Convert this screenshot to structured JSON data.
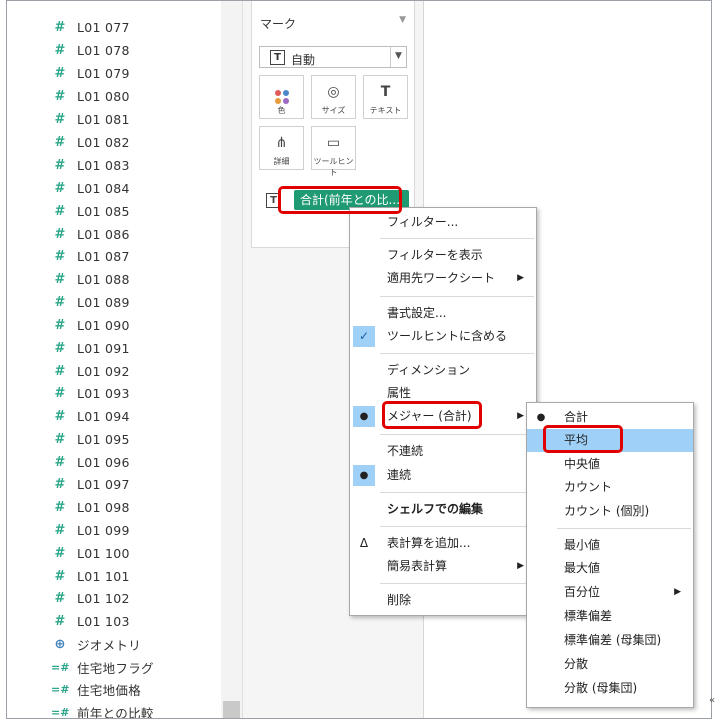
{
  "fields": [
    {
      "label": "L01 077",
      "icon": "hash-icon",
      "glyph": "#"
    },
    {
      "label": "L01 078",
      "icon": "hash-icon",
      "glyph": "#"
    },
    {
      "label": "L01 079",
      "icon": "hash-icon",
      "glyph": "#"
    },
    {
      "label": "L01 080",
      "icon": "hash-icon",
      "glyph": "#"
    },
    {
      "label": "L01 081",
      "icon": "hash-icon",
      "glyph": "#"
    },
    {
      "label": "L01 082",
      "icon": "hash-icon",
      "glyph": "#"
    },
    {
      "label": "L01 083",
      "icon": "hash-icon",
      "glyph": "#"
    },
    {
      "label": "L01 084",
      "icon": "hash-icon",
      "glyph": "#"
    },
    {
      "label": "L01 085",
      "icon": "hash-icon",
      "glyph": "#"
    },
    {
      "label": "L01 086",
      "icon": "hash-icon",
      "glyph": "#"
    },
    {
      "label": "L01 087",
      "icon": "hash-icon",
      "glyph": "#"
    },
    {
      "label": "L01 088",
      "icon": "hash-icon",
      "glyph": "#"
    },
    {
      "label": "L01 089",
      "icon": "hash-icon",
      "glyph": "#"
    },
    {
      "label": "L01 090",
      "icon": "hash-icon",
      "glyph": "#"
    },
    {
      "label": "L01 091",
      "icon": "hash-icon",
      "glyph": "#"
    },
    {
      "label": "L01 092",
      "icon": "hash-icon",
      "glyph": "#"
    },
    {
      "label": "L01 093",
      "icon": "hash-icon",
      "glyph": "#"
    },
    {
      "label": "L01 094",
      "icon": "hash-icon",
      "glyph": "#"
    },
    {
      "label": "L01 095",
      "icon": "hash-icon",
      "glyph": "#"
    },
    {
      "label": "L01 096",
      "icon": "hash-icon",
      "glyph": "#"
    },
    {
      "label": "L01 097",
      "icon": "hash-icon",
      "glyph": "#"
    },
    {
      "label": "L01 098",
      "icon": "hash-icon",
      "glyph": "#"
    },
    {
      "label": "L01 099",
      "icon": "hash-icon",
      "glyph": "#"
    },
    {
      "label": "L01 100",
      "icon": "hash-icon",
      "glyph": "#"
    },
    {
      "label": "L01 101",
      "icon": "hash-icon",
      "glyph": "#"
    },
    {
      "label": "L01 102",
      "icon": "hash-icon",
      "glyph": "#"
    },
    {
      "label": "L01 103",
      "icon": "hash-icon",
      "glyph": "#"
    },
    {
      "label": "ジオメトリ",
      "icon": "globe-icon",
      "glyph": "⊕"
    },
    {
      "label": "住宅地フラグ",
      "icon": "calc-hash-icon",
      "glyph": "=#"
    },
    {
      "label": "住宅地価格",
      "icon": "calc-hash-icon",
      "glyph": "=#"
    },
    {
      "label": "前年との比較",
      "icon": "calc-hash-icon",
      "glyph": "=#"
    }
  ],
  "marks": {
    "title": "マーク",
    "collapse_glyph": "▼",
    "type_icon": "T",
    "type_label": "自動",
    "type_drop": "▼",
    "buttons": [
      {
        "label": "色",
        "icon": "color-dots-icon"
      },
      {
        "label": "サイズ",
        "icon": "size-icon",
        "glyph": "◎"
      },
      {
        "label": "テキスト",
        "icon": "text-icon",
        "glyph": "T"
      },
      {
        "label": "詳細",
        "icon": "detail-icon",
        "glyph": "⋔"
      },
      {
        "label": "ツールヒント",
        "icon": "tooltip-icon",
        "glyph": "▭"
      }
    ],
    "pill_icon": "T",
    "pill_label": "合計(前年との比..."
  },
  "context_menu": {
    "items": [
      {
        "label": "フィルター..."
      },
      {
        "label": "フィルターを表示"
      },
      {
        "label": "適用先ワークシート",
        "arrow": "▶"
      },
      {
        "label": "書式設定..."
      },
      {
        "label": "ツールヒントに含める",
        "mark": "✓"
      },
      {
        "label": "ディメンション"
      },
      {
        "label": "属性"
      },
      {
        "label": "メジャー (合計)",
        "arrow": "▶",
        "mark": "●"
      },
      {
        "label": "不連続"
      },
      {
        "label": "連続",
        "mark": "●"
      },
      {
        "label": "シェルフでの編集"
      },
      {
        "label": "表計算を追加...",
        "mark": "Δ"
      },
      {
        "label": "簡易表計算",
        "arrow": "▶"
      },
      {
        "label": "削除"
      }
    ]
  },
  "submenu": {
    "items": [
      {
        "label": "合計",
        "mark": "●"
      },
      {
        "label": "平均"
      },
      {
        "label": "中央値"
      },
      {
        "label": "カウント"
      },
      {
        "label": "カウント (個別)"
      },
      {
        "label": "最小値"
      },
      {
        "label": "最大値"
      },
      {
        "label": "百分位",
        "arrow": "▶"
      },
      {
        "label": "標準偏差"
      },
      {
        "label": "標準偏差 (母集団)"
      },
      {
        "label": "分散"
      },
      {
        "label": "分散 (母集団)"
      }
    ]
  },
  "colors": {
    "field_icon": "#2ca68a",
    "pill": "#1f9a72",
    "highlight": "#9fd0f7",
    "annotation": "#e00000"
  },
  "corner_glyph": "«"
}
